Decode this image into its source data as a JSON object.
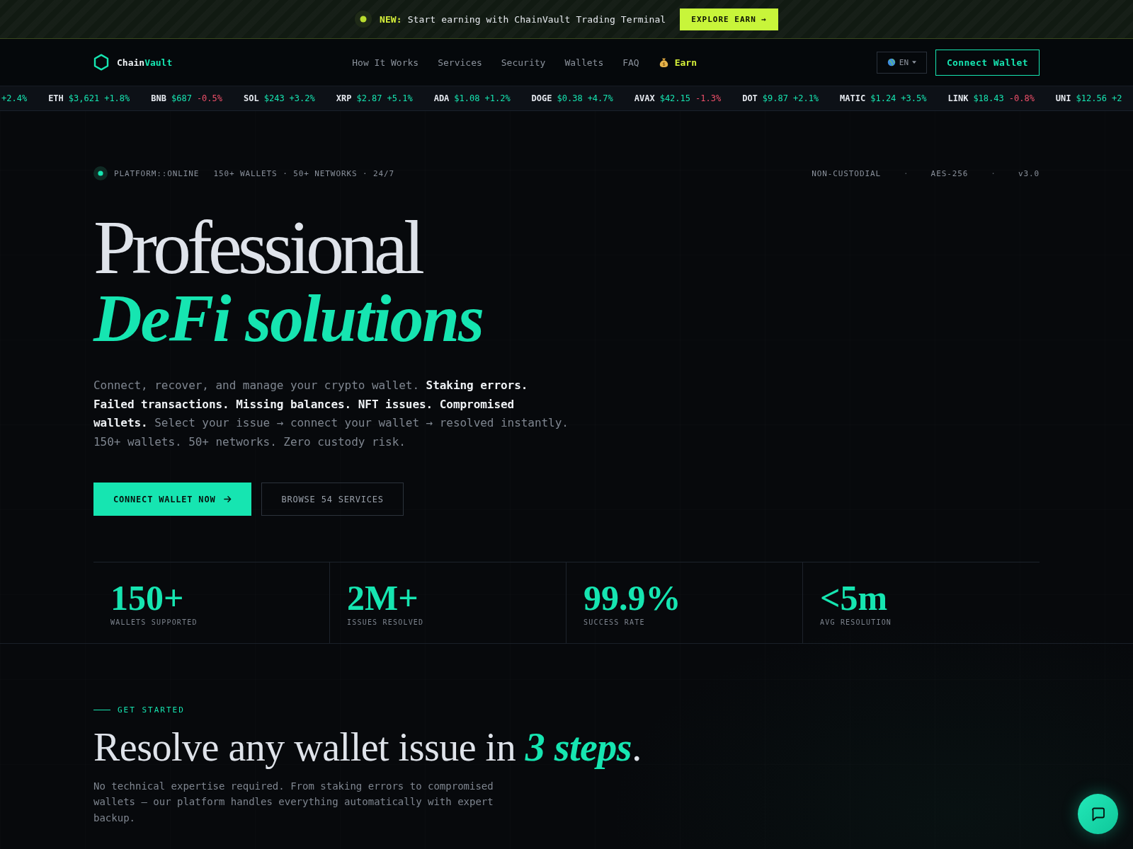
{
  "announcement": {
    "text": "**NEW:** Start earning with ChainVault Trading Terminal",
    "button": "EXPLORE EARN →"
  },
  "nav": {
    "brand": {
      "primary": "Chain",
      "accent": "Vault"
    },
    "links": [
      {
        "label": "How It Works",
        "kind": "link"
      },
      {
        "label": "Services",
        "kind": "link"
      },
      {
        "label": "Security",
        "kind": "link"
      },
      {
        "label": "Wallets",
        "kind": "link"
      },
      {
        "label": "FAQ",
        "kind": "link"
      },
      {
        "label": "Earn",
        "kind": "promo"
      }
    ],
    "language": "EN",
    "cta": "Connect Wallet"
  },
  "ticker": [
    {
      "change": "+2.4%",
      "color": "#16e5b1"
    },
    {
      "symbol": "ETH",
      "price": "$3,621",
      "change": "+1.8%",
      "color": "#16e5b1"
    },
    {
      "symbol": "BNB",
      "price": "$687",
      "change": "-0.5%",
      "color": "#f0506a"
    },
    {
      "symbol": "SOL",
      "price": "$243",
      "change": "+3.2%",
      "color": "#16e5b1"
    },
    {
      "symbol": "XRP",
      "price": "$2.87",
      "change": "+5.1%",
      "color": "#16e5b1"
    },
    {
      "symbol": "ADA",
      "price": "$1.08",
      "change": "+1.2%",
      "color": "#16e5b1"
    },
    {
      "symbol": "DOGE",
      "price": "$0.38",
      "change": "+4.7%",
      "color": "#16e5b1"
    },
    {
      "symbol": "AVAX",
      "price": "$42.15",
      "change": "-1.3%",
      "color": "#f0506a"
    },
    {
      "symbol": "DOT",
      "price": "$9.87",
      "change": "+2.1%",
      "color": "#16e5b1"
    },
    {
      "symbol": "MATIC",
      "price": "$1.24",
      "change": "+3.5%",
      "color": "#16e5b1"
    },
    {
      "symbol": "LINK",
      "price": "$18.43",
      "change": "-0.8%",
      "color": "#f0506a"
    },
    {
      "symbol": "UNI",
      "price": "$12.56",
      "change": "+2",
      "color": "#16e5b1"
    }
  ],
  "hero": {
    "status": {
      "online": true,
      "label": "PLATFORM::ONLINE"
    },
    "summary": "150+ WALLETS · 50+ NETWORKS · 24/7",
    "tags": [
      {
        "text": "NON-CUSTODIAL",
        "kind": "tag"
      },
      {
        "text": "·",
        "kind": "separator"
      },
      {
        "text": "AES-256",
        "kind": "tag"
      },
      {
        "text": "·",
        "kind": "separator"
      },
      {
        "text": "v3.0",
        "kind": "tag"
      }
    ],
    "title": "Professional",
    "title_accent": "DeFi solutions",
    "description": "Connect, recover, and manage your crypto wallet. **Staking errors. Failed transactions. Missing balances. NFT issues. Compromised wallets.** Select your issue → connect your wallet → resolved instantly. 150+ wallets. 50+ networks. Zero custody risk.",
    "buttons": [
      {
        "label": "CONNECT WALLET NOW",
        "kind": "primary"
      },
      {
        "label": "BROWSE 54 SERVICES",
        "kind": "secondary"
      }
    ],
    "stats": [
      {
        "value": "150+",
        "label": "WALLETS SUPPORTED"
      },
      {
        "value": "2M+",
        "label": "ISSUES RESOLVED"
      },
      {
        "value": "99.9%",
        "label": "SUCCESS RATE"
      },
      {
        "value": "<5m",
        "label": "AVG RESOLUTION"
      }
    ]
  },
  "get_started": {
    "eyebrow": "GET STARTED",
    "heading": "Resolve any wallet issue in *3 steps*.",
    "description": "No technical expertise required. From staking errors to compromised wallets — our platform handles everything automatically with expert backup."
  }
}
